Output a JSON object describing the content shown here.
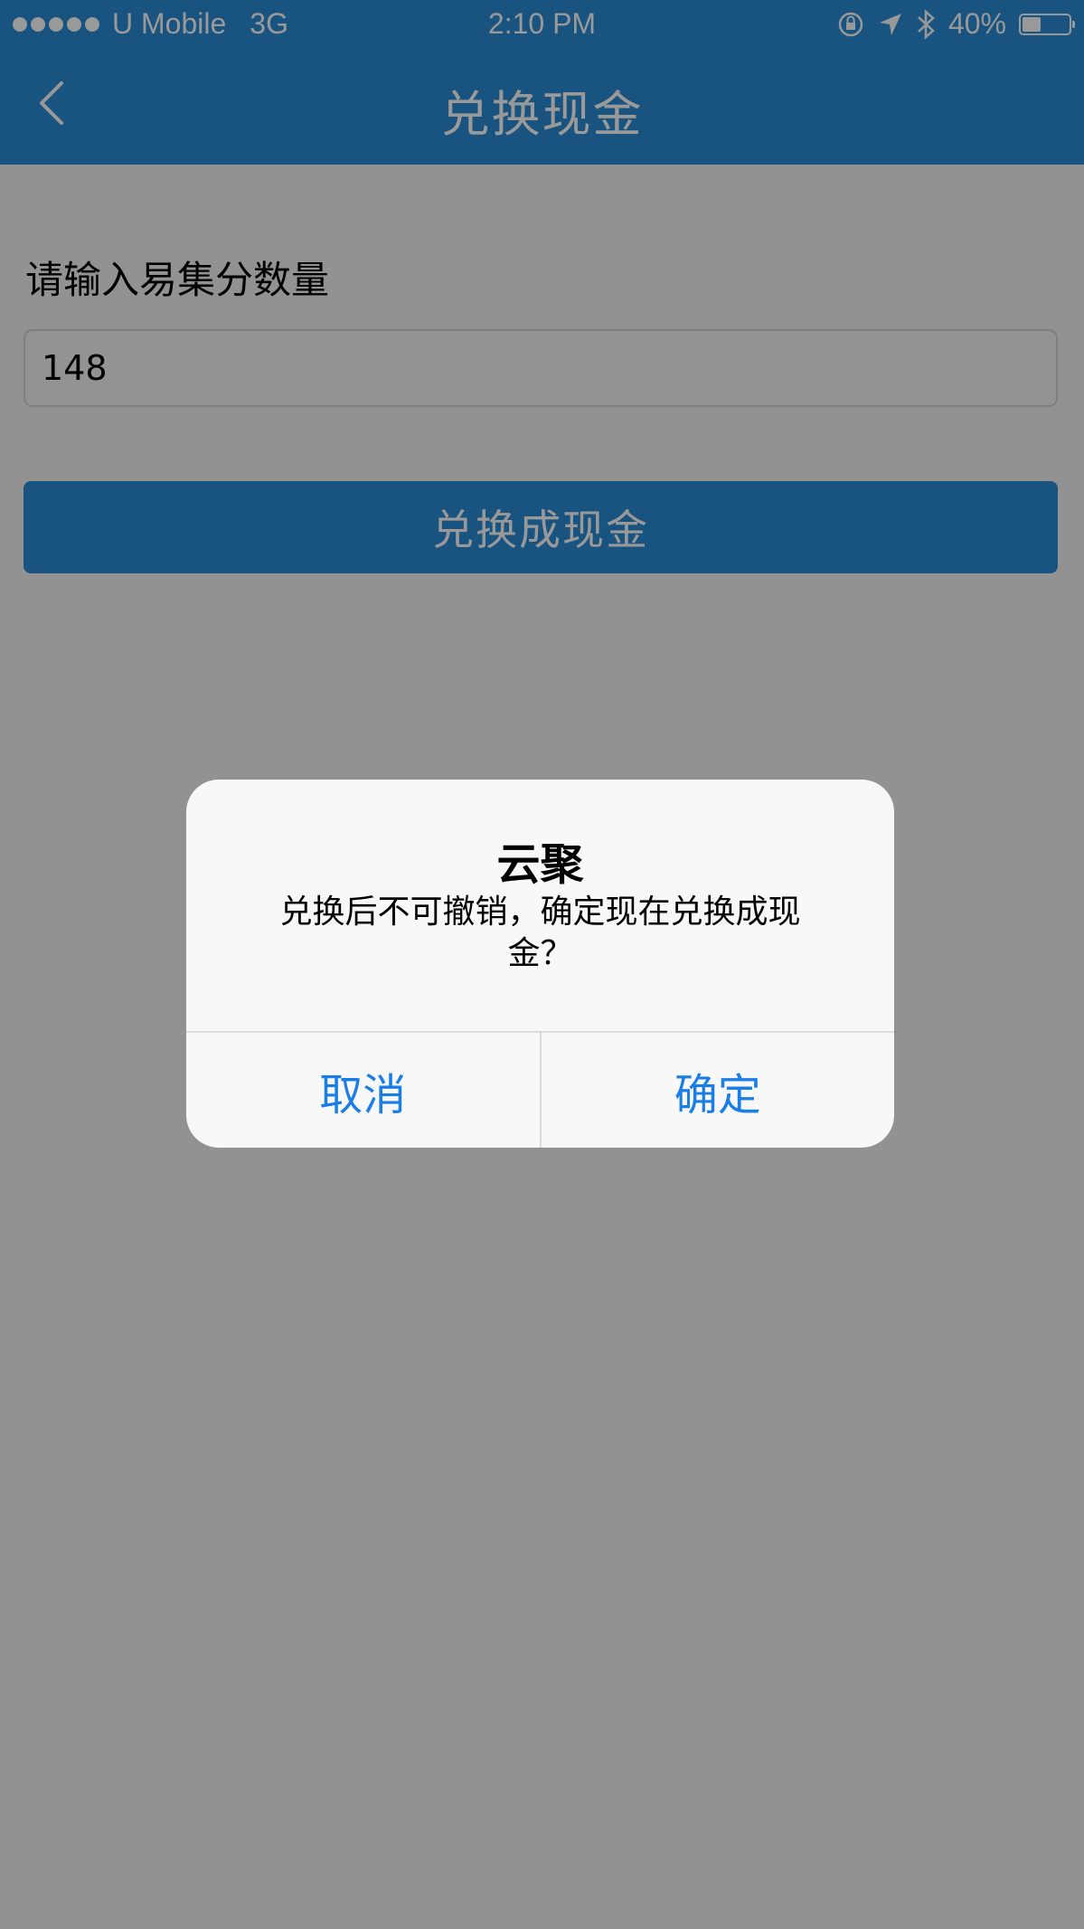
{
  "status_bar": {
    "carrier": "U Mobile",
    "network": "3G",
    "time": "2:10 PM",
    "battery": "40%",
    "battery_level": 0.4
  },
  "nav": {
    "title": "兑换现金"
  },
  "form": {
    "label": "请输入易集分数量",
    "amount_value": "148",
    "exchange_button": "兑换成现金"
  },
  "alert": {
    "title": "云聚",
    "message": "兑换后不可撤销，确定现在兑换成现金？",
    "cancel": "取消",
    "confirm": "确定"
  },
  "colors": {
    "brand": "#2a8ad4",
    "alert_button": "#1a7ee6"
  }
}
